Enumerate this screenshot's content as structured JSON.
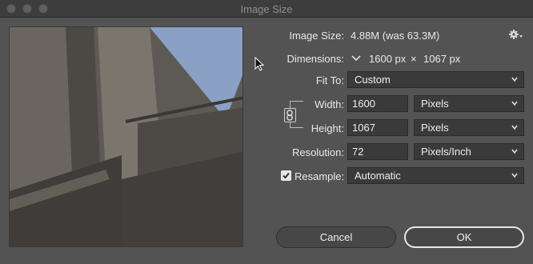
{
  "window": {
    "title": "Image Size"
  },
  "image_size": {
    "label": "Image Size:",
    "value": "4.88M (was 63.3M)"
  },
  "dimensions": {
    "label": "Dimensions:",
    "width": "1600 px",
    "times": "×",
    "height": "1067 px"
  },
  "fit_to": {
    "label": "Fit To:",
    "value": "Custom"
  },
  "width": {
    "label": "Width:",
    "value": "1600",
    "unit": "Pixels"
  },
  "height": {
    "label": "Height:",
    "value": "1067",
    "unit": "Pixels"
  },
  "resolution": {
    "label": "Resolution:",
    "value": "72",
    "unit": "Pixels/Inch"
  },
  "resample": {
    "label": "Resample:",
    "value": "Automatic",
    "checked": true
  },
  "buttons": {
    "cancel": "Cancel",
    "ok": "OK"
  },
  "icons": {
    "gear": "gear-icon",
    "chain": "chain-link-icon",
    "dimensions_toggle": "chevron-down-icon",
    "select_arrow": "chevron-updown-icon",
    "check": "checkmark-icon",
    "cursor": "mouse-pointer-icon"
  }
}
